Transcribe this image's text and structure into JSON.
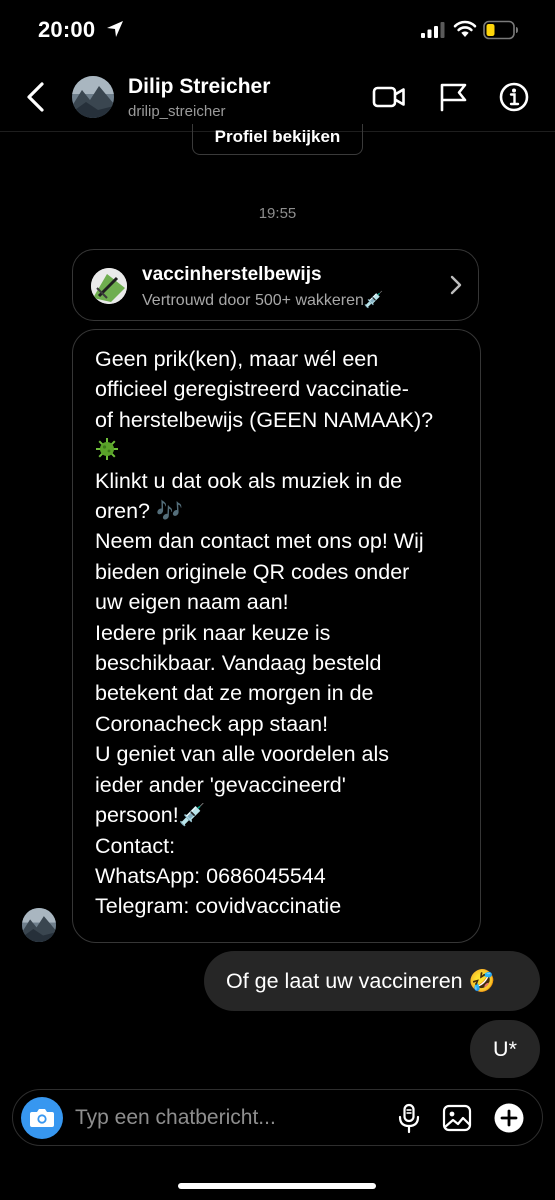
{
  "status_bar": {
    "time": "20:00"
  },
  "header": {
    "contact_name": "Dilip Streicher",
    "contact_handle": "drilip_streicher",
    "view_profile_label": "Profiel bekijken"
  },
  "timestamp": "19:55",
  "link_card": {
    "title": "vaccinherstelbewijs",
    "subtitle": "Vertrouwd door 500+ wakkeren💉"
  },
  "message": {
    "lines": [
      "Geen prik(ken), maar wél een",
      "officieel geregistreerd vaccinatie-",
      "of herstelbewijs (GEEN NAMAAK)?",
      "",
      "Klinkt u dat ook als muziek in de",
      "oren? 🎶",
      "Neem dan contact met ons op! Wij",
      "bieden originele QR codes onder",
      "uw eigen naam aan!",
      "Iedere prik naar keuze is",
      "beschikbaar. Vandaag besteld",
      "betekent dat ze morgen in de",
      "Coronacheck app staan!",
      "U geniet van alle voordelen als",
      "ieder ander 'gevaccineerd'",
      "persoon!💉",
      "Contact:",
      "WhatsApp: 0686045544",
      "Telegram: covidvaccinatie"
    ]
  },
  "replies": [
    "Of ge laat uw vaccineren 🤣",
    "U*"
  ],
  "composer": {
    "placeholder": "Typ een chatbericht..."
  },
  "colors": {
    "background": "#000000",
    "bubble_sent": "#262626",
    "bubble_border": "#363636",
    "accent_blue": "#3797f0",
    "secondary_text": "#8e8e8e",
    "battery_low": "#ffd60a"
  }
}
